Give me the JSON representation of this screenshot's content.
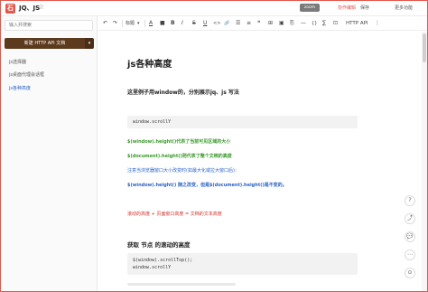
{
  "app": {
    "title": "JQ、JS",
    "logo_text": "石"
  },
  "topbar": {
    "share_label": "协作编辑",
    "save_label": "保存",
    "more_label": "更多功能",
    "zoom_tooltip": "zoom"
  },
  "sidebar": {
    "search_placeholder": "输入并搜索",
    "new_doc_label": "新建 HTTP API 文档",
    "new_doc_arrow": "▾",
    "items": [
      {
        "label": "js选择器",
        "active": false
      },
      {
        "label": "js桌面代理会话框",
        "active": false
      },
      {
        "label": "js各种高度",
        "active": true
      }
    ]
  },
  "toolbar": {
    "undo": "↶",
    "redo": "↷",
    "heading": "标题",
    "heading_arrow": "▾",
    "font_color": "A",
    "bg_color": "■",
    "bold": "B",
    "italic": "I",
    "strike": "S",
    "underline": "U",
    "code": "<>",
    "link": "🔗",
    "ul": "☰",
    "ol": "≡",
    "quote": "❝",
    "table": "⊞",
    "image": "▣",
    "attach": "⎘",
    "hr": "—",
    "codeblock": "{}",
    "formula": "∑",
    "map": "⊡",
    "http_api": "HTTP API",
    "more": "⋮"
  },
  "content": {
    "title": "js各种高度",
    "intro": "这里例子用window的，分别展示jq、js 写法",
    "code_window_scroll": "window.scrollY",
    "lines_green": [
      "$(window).height()代表了当前可见区域的大小",
      "$(document).height()则代表了整个文档的高度"
    ],
    "line_blue_note": "注意当浏览器窗口大小改变时(如最大化或拉大窗口后)：",
    "line_blue_bold": "$(window).height() 随之改变，但是$(document).height()是不变的。",
    "line_red": "滚动的高度 + 页面窗口高度 = 文档的文本高度",
    "subhead": "获取 节点 的滚动的高度",
    "code_scroll_lines": [
      "$(window).scrollTop();",
      "window.scrollY"
    ]
  },
  "rail": {
    "buttons": [
      "?",
      "⤴",
      "💬",
      "⋯",
      "⊙"
    ]
  },
  "colors": {
    "accent": "#e2574c",
    "new_doc_bg": "#5c3a1e",
    "green": "#3a9a2b",
    "blue": "#2a63c9",
    "red": "#d8322c"
  }
}
